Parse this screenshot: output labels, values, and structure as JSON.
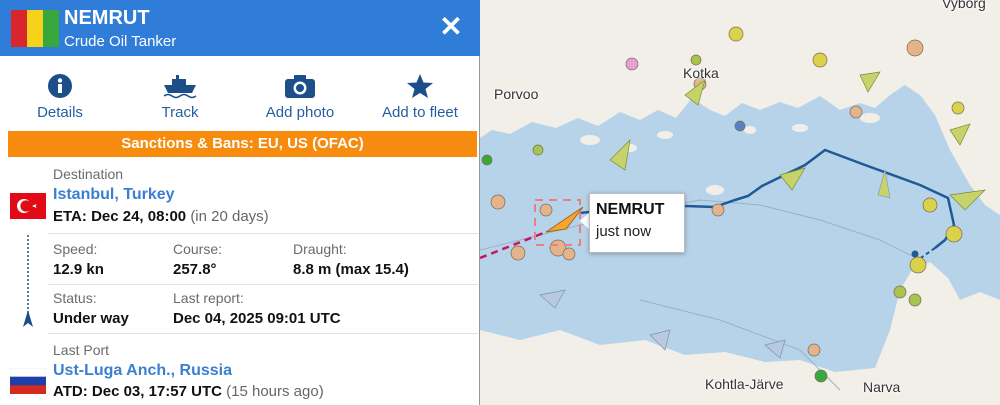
{
  "vessel": {
    "name": "NEMRUT",
    "type": "Crude Oil Tanker",
    "flag_colors": [
      "#d8262c",
      "#f7d21a",
      "#39a83c"
    ]
  },
  "actions": [
    {
      "label": "Details",
      "icon": "info-icon"
    },
    {
      "label": "Track",
      "icon": "ship-track-icon"
    },
    {
      "label": "Add photo",
      "icon": "camera-icon"
    },
    {
      "label": "Add to fleet",
      "icon": "star-icon"
    }
  ],
  "sanctions": "Sanctions & Bans: EU, US (OFAC)",
  "destination": {
    "label": "Destination",
    "port": "Istanbul, Turkey",
    "eta_label": "ETA:",
    "eta": "Dec 24, 08:00",
    "eta_rel": "(in 20 days)",
    "flag_icon": "turkey-flag-icon"
  },
  "stats": {
    "speed_label": "Speed:",
    "speed": "12.9 kn",
    "course_label": "Course:",
    "course": "257.8°",
    "draught_label": "Draught:",
    "draught": "8.8 m (max 15.4)",
    "status_label": "Status:",
    "status": "Under way",
    "last_report_label": "Last report:",
    "last_report": "Dec 04, 2025 09:01 UTC"
  },
  "last_port": {
    "label": "Last Port",
    "port": "Ust-Luga Anch., Russia",
    "atd_label": "ATD:",
    "atd": "Dec 03, 17:57 UTC",
    "atd_rel": "(15 hours ago)",
    "flag_icon": "russia-flag-icon"
  },
  "map": {
    "labels": [
      "Porvoo",
      "Kotka",
      "Vyborg",
      "Kohtla-Järve",
      "Narva"
    ],
    "callout": {
      "name": "NEMRUT",
      "time": "just now"
    },
    "colors": {
      "sea": "#b7d3ea",
      "land": "#f1efe8",
      "track": "#1f5a94",
      "ship": "#f7a532"
    }
  }
}
